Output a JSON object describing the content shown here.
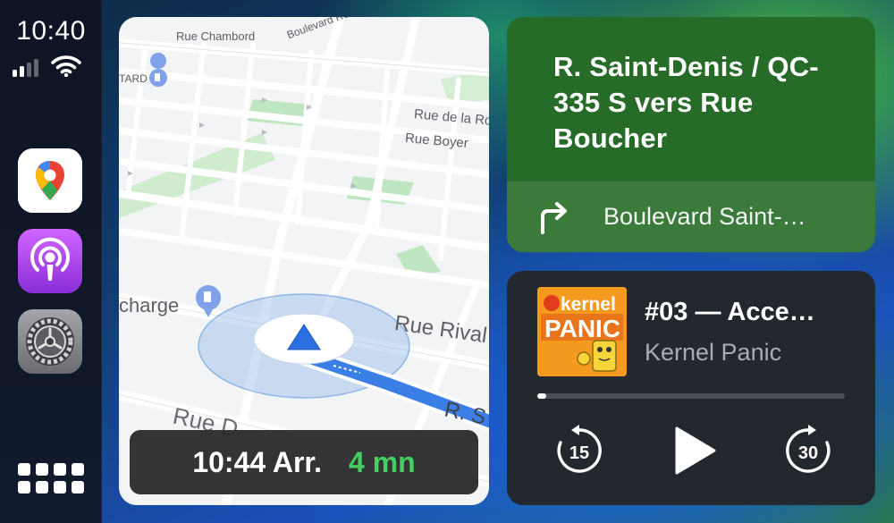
{
  "status": {
    "time": "10:40",
    "signal_bars_active": 2,
    "signal_bars_total": 4
  },
  "dock": {
    "apps": [
      {
        "name": "Google Maps",
        "icon": "google-maps-icon"
      },
      {
        "name": "Podcasts",
        "icon": "podcasts-icon"
      },
      {
        "name": "Settings",
        "icon": "settings-gear-icon"
      }
    ],
    "app_grid_icon": "app-grid-icon"
  },
  "map": {
    "labels": {
      "chambord": "Rue Chambord",
      "boulevard_ros": "Boulevard Ros",
      "tard": "TARD",
      "rue_de_la_ro": "Rue de la Ro",
      "boyer": "Rue Boyer",
      "charge": "charge",
      "rivard": "Rue Rival",
      "rue_bottom": "Rue D",
      "route_sign": "R. S"
    },
    "eta": {
      "arrival": "10:44 Arr.",
      "duration": "4 mn"
    }
  },
  "direction": {
    "title": "R. Saint-Denis / QC-335 S vers Rue Boucher",
    "next_instruction": "Boulevard Saint-…",
    "turn_icon": "turn-right-arrow-icon",
    "accent": "#276b28"
  },
  "now_playing": {
    "title": "#03 — Acce…",
    "artist": "Kernel Panic",
    "artwork_text_top": "kernel",
    "artwork_text_bottom": "PANIC",
    "progress": 0.03,
    "skip_back_seconds": "15",
    "skip_forward_seconds": "30"
  },
  "colors": {
    "eta_green": "#43d060",
    "route_blue": "#3a7ee6"
  }
}
